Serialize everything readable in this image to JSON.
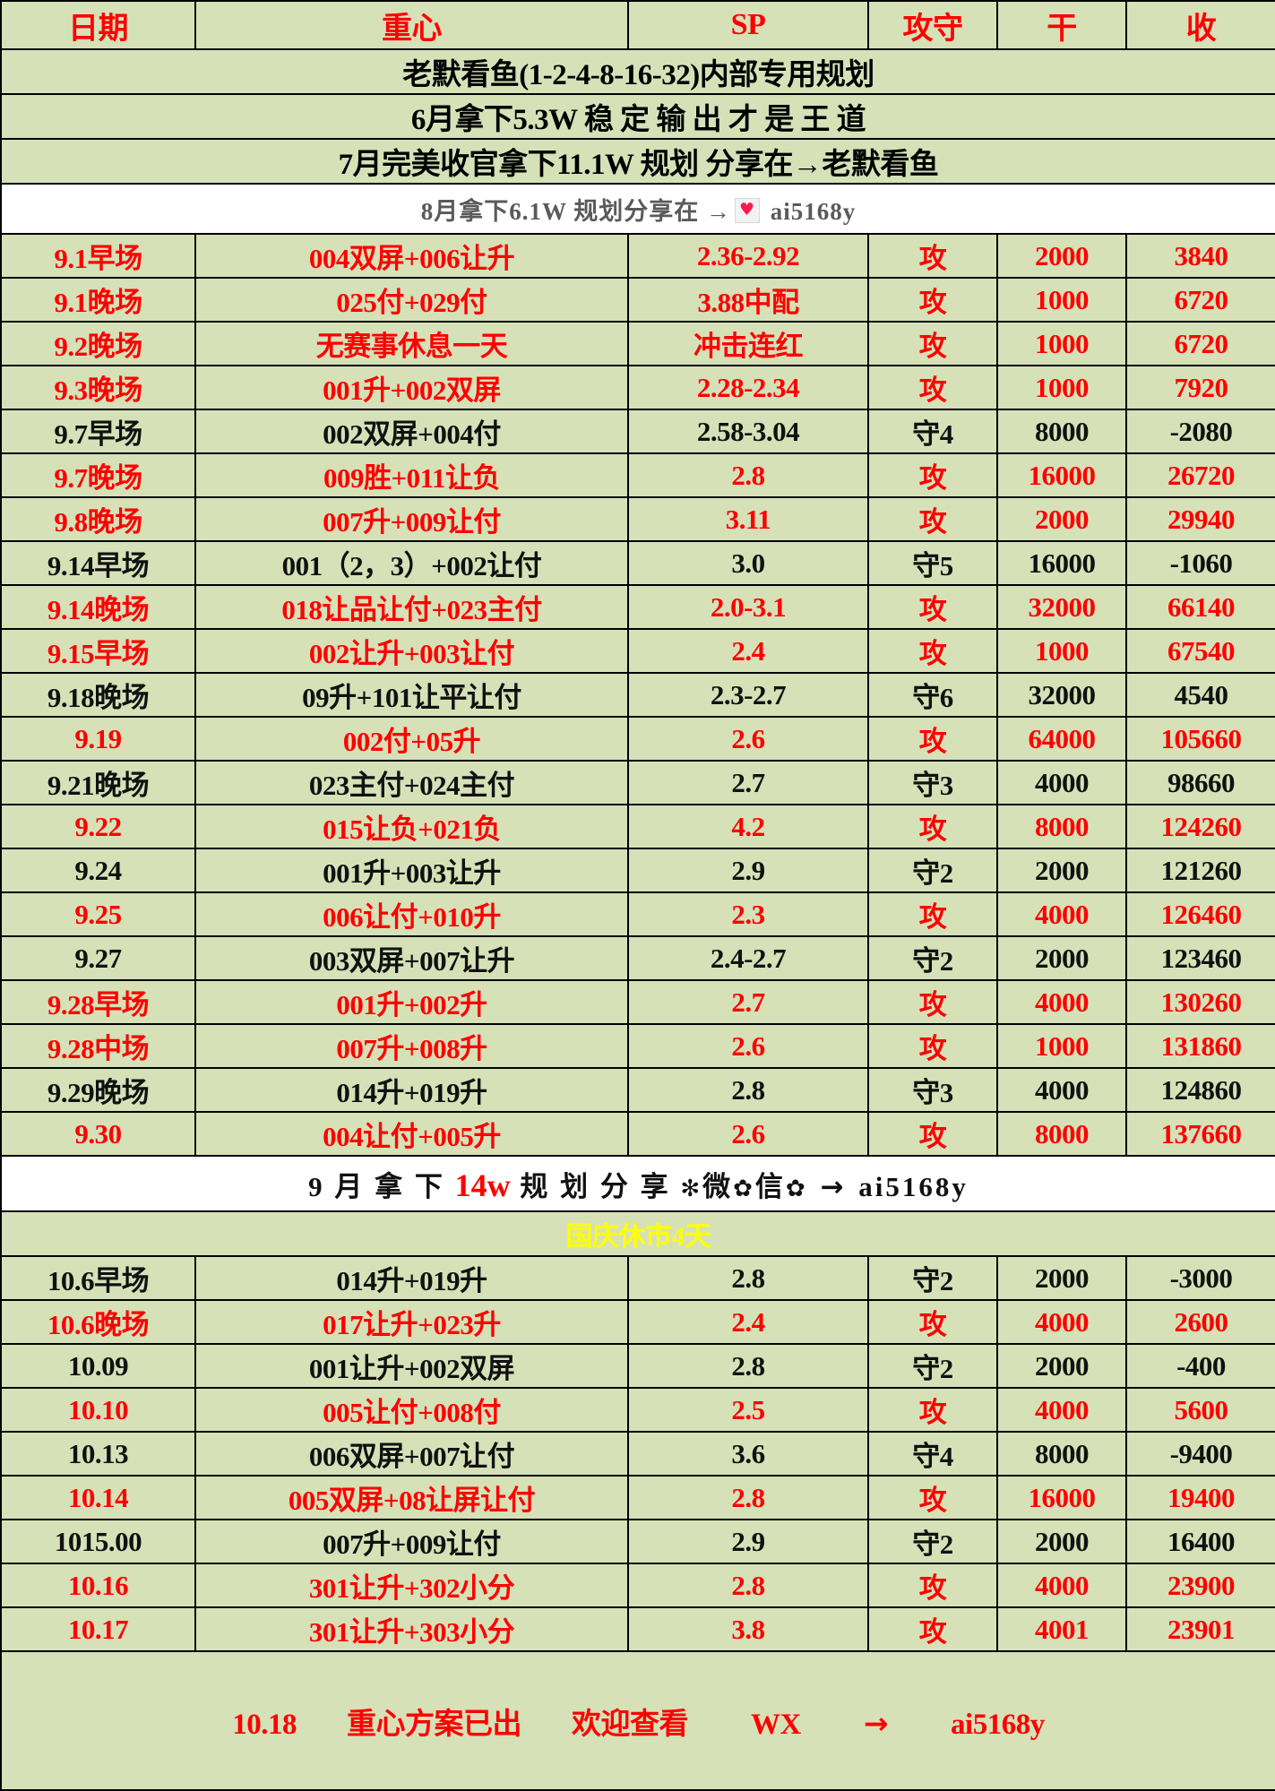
{
  "header": {
    "columns": [
      "日期",
      "重心",
      "SP",
      "攻守",
      "干",
      "收"
    ]
  },
  "banners": [
    {
      "text": "老默看鱼(1-2-4-8-16-32)内部专用规划"
    },
    {
      "text": "6月拿下5.3W 稳 定 输 出 才 是 王 道"
    },
    {
      "text": "7月完美收官拿下11.1W 规划 分享在→老默看鱼"
    }
  ],
  "promo_august": {
    "prefix": "8月拿下6.1W 规划分享在 →",
    "icon": "heart-icon",
    "handle": "ai5168y"
  },
  "promo_september": {
    "prefix": "9 月 拿 下",
    "highlight": "14w",
    "middle": "规 划 分 享",
    "wechat": "微",
    "wechat2": "信",
    "arrow": "→",
    "handle": "ai5168y"
  },
  "holiday_note": "国庆休市4天",
  "rows_september": [
    {
      "date": "9.1早场",
      "plan": "004双屏+006让升",
      "sp": "2.36-2.92",
      "gs": "攻",
      "dry": "2000",
      "gain": "3840",
      "color": "red"
    },
    {
      "date": "9.1晚场",
      "plan": "025付+029付",
      "sp": "3.88中配",
      "gs": "攻",
      "dry": "1000",
      "gain": "6720",
      "color": "red"
    },
    {
      "date": "9.2晚场",
      "plan": "无赛事休息一天",
      "sp": "冲击连红",
      "gs": "攻",
      "dry": "1000",
      "gain": "6720",
      "color": "red"
    },
    {
      "date": "9.3晚场",
      "plan": "001升+002双屏",
      "sp": "2.28-2.34",
      "gs": "攻",
      "dry": "1000",
      "gain": "7920",
      "color": "red"
    },
    {
      "date": "9.7早场",
      "plan": "002双屏+004付",
      "sp": "2.58-3.04",
      "gs": "守4",
      "dry": "8000",
      "gain": "-2080",
      "color": "black"
    },
    {
      "date": "9.7晚场",
      "plan": "009胜+011让负",
      "sp": "2.8",
      "gs": "攻",
      "dry": "16000",
      "gain": "26720",
      "color": "red"
    },
    {
      "date": "9.8晚场",
      "plan": "007升+009让付",
      "sp": "3.11",
      "gs": "攻",
      "dry": "2000",
      "gain": "29940",
      "color": "red"
    },
    {
      "date": "9.14早场",
      "plan": "001（2，3）+002让付",
      "sp": "3.0",
      "gs": "守5",
      "dry": "16000",
      "gain": "-1060",
      "color": "black"
    },
    {
      "date": "9.14晚场",
      "plan": "018让品让付+023主付",
      "sp": "2.0-3.1",
      "gs": "攻",
      "dry": "32000",
      "gain": "66140",
      "color": "red"
    },
    {
      "date": "9.15早场",
      "plan": "002让升+003让付",
      "sp": "2.4",
      "gs": "攻",
      "dry": "1000",
      "gain": "67540",
      "color": "red"
    },
    {
      "date": "9.18晚场",
      "plan": "09升+101让平让付",
      "sp": "2.3-2.7",
      "gs": "守6",
      "dry": "32000",
      "gain": "4540",
      "color": "black"
    },
    {
      "date": "9.19",
      "plan": "002付+05升",
      "sp": "2.6",
      "gs": "攻",
      "dry": "64000",
      "gain": "105660",
      "color": "red"
    },
    {
      "date": "9.21晚场",
      "plan": "023主付+024主付",
      "sp": "2.7",
      "gs": "守3",
      "dry": "4000",
      "gain": "98660",
      "color": "black"
    },
    {
      "date": "9.22",
      "plan": "015让负+021负",
      "sp": "4.2",
      "gs": "攻",
      "dry": "8000",
      "gain": "124260",
      "color": "red"
    },
    {
      "date": "9.24",
      "plan": "001升+003让升",
      "sp": "2.9",
      "gs": "守2",
      "dry": "2000",
      "gain": "121260",
      "color": "black"
    },
    {
      "date": "9.25",
      "plan": "006让付+010升",
      "sp": "2.3",
      "gs": "攻",
      "dry": "4000",
      "gain": "126460",
      "color": "red"
    },
    {
      "date": "9.27",
      "plan": "003双屏+007让升",
      "sp": "2.4-2.7",
      "gs": "守2",
      "dry": "2000",
      "gain": "123460",
      "color": "black"
    },
    {
      "date": "9.28早场",
      "plan": "001升+002升",
      "sp": "2.7",
      "gs": "攻",
      "dry": "4000",
      "gain": "130260",
      "color": "red"
    },
    {
      "date": "9.28中场",
      "plan": "007升+008升",
      "sp": "2.6",
      "gs": "攻",
      "dry": "1000",
      "gain": "131860",
      "color": "red"
    },
    {
      "date": "9.29晚场",
      "plan": "014升+019升",
      "sp": "2.8",
      "gs": "守3",
      "dry": "4000",
      "gain": "124860",
      "color": "black"
    },
    {
      "date": "9.30",
      "plan": "004让付+005升",
      "sp": "2.6",
      "gs": "攻",
      "dry": "8000",
      "gain": "137660",
      "color": "red"
    }
  ],
  "rows_october": [
    {
      "date": "10.6早场",
      "plan": "014升+019升",
      "sp": "2.8",
      "gs": "守2",
      "dry": "2000",
      "gain": "-3000",
      "color": "black"
    },
    {
      "date": "10.6晚场",
      "plan": "017让升+023升",
      "sp": "2.4",
      "gs": "攻",
      "dry": "4000",
      "gain": "2600",
      "color": "red"
    },
    {
      "date": "10.09",
      "plan": "001让升+002双屏",
      "sp": "2.8",
      "gs": "守2",
      "dry": "2000",
      "gain": "-400",
      "color": "black"
    },
    {
      "date": "10.10",
      "plan": "005让付+008付",
      "sp": "2.5",
      "gs": "攻",
      "dry": "4000",
      "gain": "5600",
      "color": "red"
    },
    {
      "date": "10.13",
      "plan": "006双屏+007让付",
      "sp": "3.6",
      "gs": "守4",
      "dry": "8000",
      "gain": "-9400",
      "color": "black"
    },
    {
      "date": "10.14",
      "plan": "005双屏+08让屏让付",
      "sp": "2.8",
      "gs": "攻",
      "dry": "16000",
      "gain": "19400",
      "color": "red"
    },
    {
      "date": "1015.00",
      "plan": "007升+009让付",
      "sp": "2.9",
      "gs": "守2",
      "dry": "2000",
      "gain": "16400",
      "color": "black"
    },
    {
      "date": "10.16",
      "plan": "301让升+302小分",
      "sp": "2.8",
      "gs": "攻",
      "dry": "4000",
      "gain": "23900",
      "color": "red"
    },
    {
      "date": "10.17",
      "plan": "301让升+303小分",
      "sp": "3.8",
      "gs": "攻",
      "dry": "4001",
      "gain": "23901",
      "color": "red"
    }
  ],
  "footer": {
    "date": "10.18",
    "status": "重心方案已出",
    "invite": "欢迎查看",
    "channel": "WX",
    "arrow": "→",
    "handle": "ai5168y"
  },
  "colors": {
    "sheet_background": "#d6e1b8",
    "accent_red": "#ff0000",
    "text_black": "#111111",
    "promo_background": "#ffffff",
    "promo_text": "#5a5a5a",
    "holiday_text": "#ffff00",
    "grid_line": "#000000"
  }
}
